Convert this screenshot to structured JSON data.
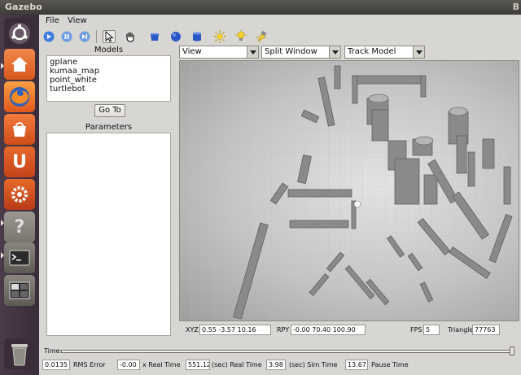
{
  "window": {
    "title": "Gazebo",
    "corner": "B"
  },
  "menu": [
    "File",
    "View"
  ],
  "toolbar_icons": [
    "play-icon",
    "pause-icon",
    "step-icon",
    "arrow-icon",
    "hand-icon",
    "box-icon",
    "sphere-icon",
    "cylinder-icon",
    "sun-light-icon",
    "bulb-light-icon",
    "spot-light-icon"
  ],
  "models": {
    "label": "Models",
    "items": [
      "gplane",
      "kumaa_map",
      "point_white",
      "turtlebot"
    ],
    "goto_label": "Go To"
  },
  "parameters": {
    "label": "Parameters"
  },
  "view_controls": {
    "view": "View",
    "split": "Split Window",
    "track": "Track Model"
  },
  "stats": {
    "xyz_label": "XYZ",
    "xyz_value": "0.55  -3.57  10.16",
    "rpy_label": "RPY",
    "rpy_value": "-0.00  70.40 100.90",
    "fps_label": "FPS",
    "fps_value": "5",
    "tri_label": "Triangles",
    "tri_value": "77763"
  },
  "time": {
    "label": "Time:"
  },
  "bottom": {
    "rms_value": "0.0135",
    "rms_label": "RMS Error",
    "xreal_value": "-0.00",
    "xreal_label": "x Real Time",
    "real_value": "551.12",
    "real_label": "(sec) Real Time",
    "sim_value": "3.98",
    "sim_label": "(sec) Sim Time",
    "pause_value": "13.67",
    "pause_label": "Pause Time"
  },
  "launcher": [
    "ubuntu-logo-icon",
    "home-folder-icon",
    "firefox-icon",
    "software-center-icon",
    "ubuntu-one-icon",
    "system-settings-icon",
    "help-icon",
    "terminal-icon",
    "workspace-switcher-icon",
    "trash-icon"
  ],
  "colors": {
    "accent_blue": "#2a57c8",
    "launcher": "#44343f",
    "wall": "#777777"
  }
}
